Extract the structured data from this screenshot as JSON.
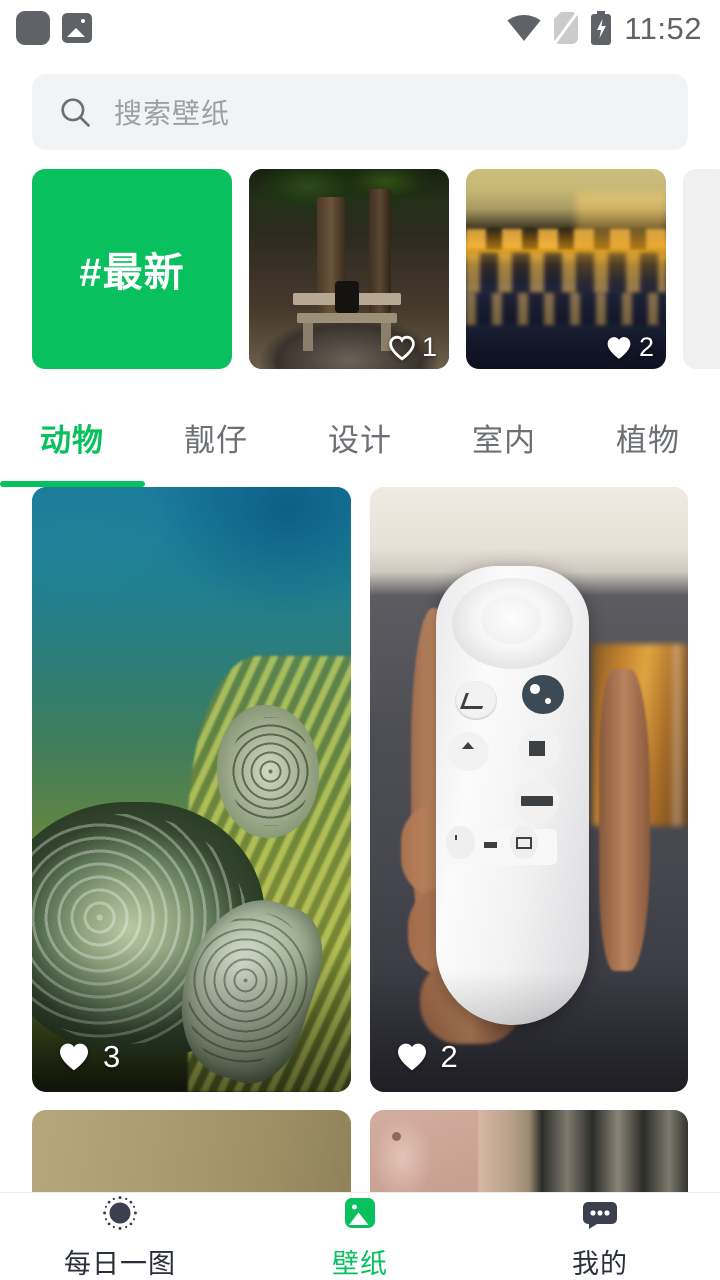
{
  "statusbar": {
    "time": "11:52",
    "icons": [
      "notification-blank-icon",
      "photo-notification-icon",
      "wifi-icon",
      "no-sim-icon",
      "battery-charging-icon"
    ]
  },
  "search": {
    "placeholder": "搜索壁纸",
    "icon": "search-icon"
  },
  "carousel": {
    "items": [
      {
        "label": "#最新",
        "type": "tag",
        "likes": null
      },
      {
        "label": "",
        "type": "photo",
        "alt": "forest-bench",
        "likes": "1"
      },
      {
        "label": "",
        "type": "photo",
        "alt": "sunset-lake",
        "likes": "2"
      },
      {
        "label": "",
        "type": "peek",
        "alt": "next-card",
        "likes": null
      }
    ]
  },
  "tabs": {
    "active_index": 0,
    "items": [
      {
        "label": "动物"
      },
      {
        "label": "靓仔"
      },
      {
        "label": "设计"
      },
      {
        "label": "室内"
      },
      {
        "label": "植物"
      }
    ]
  },
  "grid": {
    "left": [
      {
        "alt": "sea-turtle-coral",
        "likes": "3"
      },
      {
        "alt": "khaki-gradient",
        "likes": ""
      }
    ],
    "right": [
      {
        "alt": "hand-holding-remote",
        "likes": "2"
      },
      {
        "alt": "pink-wall-window-grille",
        "likes": ""
      }
    ]
  },
  "bottomnav": {
    "active_index": 1,
    "items": [
      {
        "label": "每日一图",
        "icon": "daily-sun-icon"
      },
      {
        "label": "壁纸",
        "icon": "wallpaper-image-icon"
      },
      {
        "label": "我的",
        "icon": "chat-bubble-icon"
      }
    ]
  },
  "colors": {
    "accent": "#09c05e",
    "search_bg": "#f2f3f5",
    "text_muted": "#6c6f73",
    "status_icon": "#5f6368"
  }
}
